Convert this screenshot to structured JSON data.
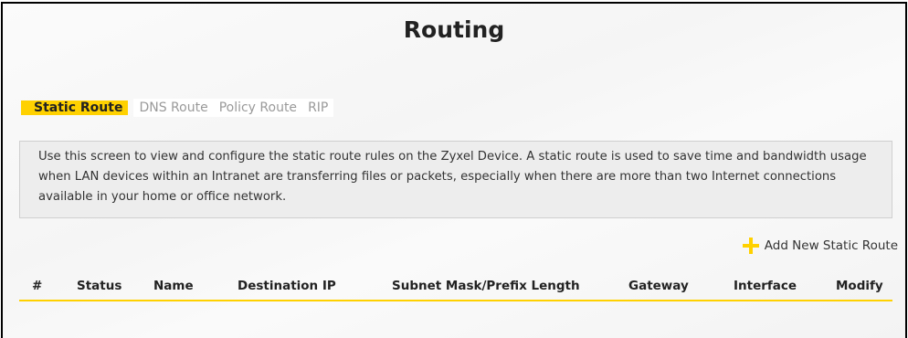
{
  "page": {
    "title": "Routing"
  },
  "tabs": [
    {
      "label_highlight": "Static Route",
      "active": true
    },
    {
      "label": "DNS Route"
    },
    {
      "label": "Policy Route"
    },
    {
      "label": "RIP"
    }
  ],
  "info": {
    "text": "Use this screen to view and configure the static route rules on the Zyxel Device. A static route is used to save time and bandwidth usage when LAN devices within an Intranet are transferring files or packets, especially when there are more than two Internet connections available in your home or office network."
  },
  "actions": {
    "add_label": "Add New Static Route",
    "add_icon": "plus-icon"
  },
  "table": {
    "columns": [
      "#",
      "Status",
      "Name",
      "Destination IP",
      "Subnet Mask/Prefix Length",
      "Gateway",
      "Interface",
      "Modify"
    ]
  },
  "colors": {
    "accent": "#ffd100",
    "info_bg": "#ededed",
    "inactive_tab": "#9a9a9a"
  }
}
